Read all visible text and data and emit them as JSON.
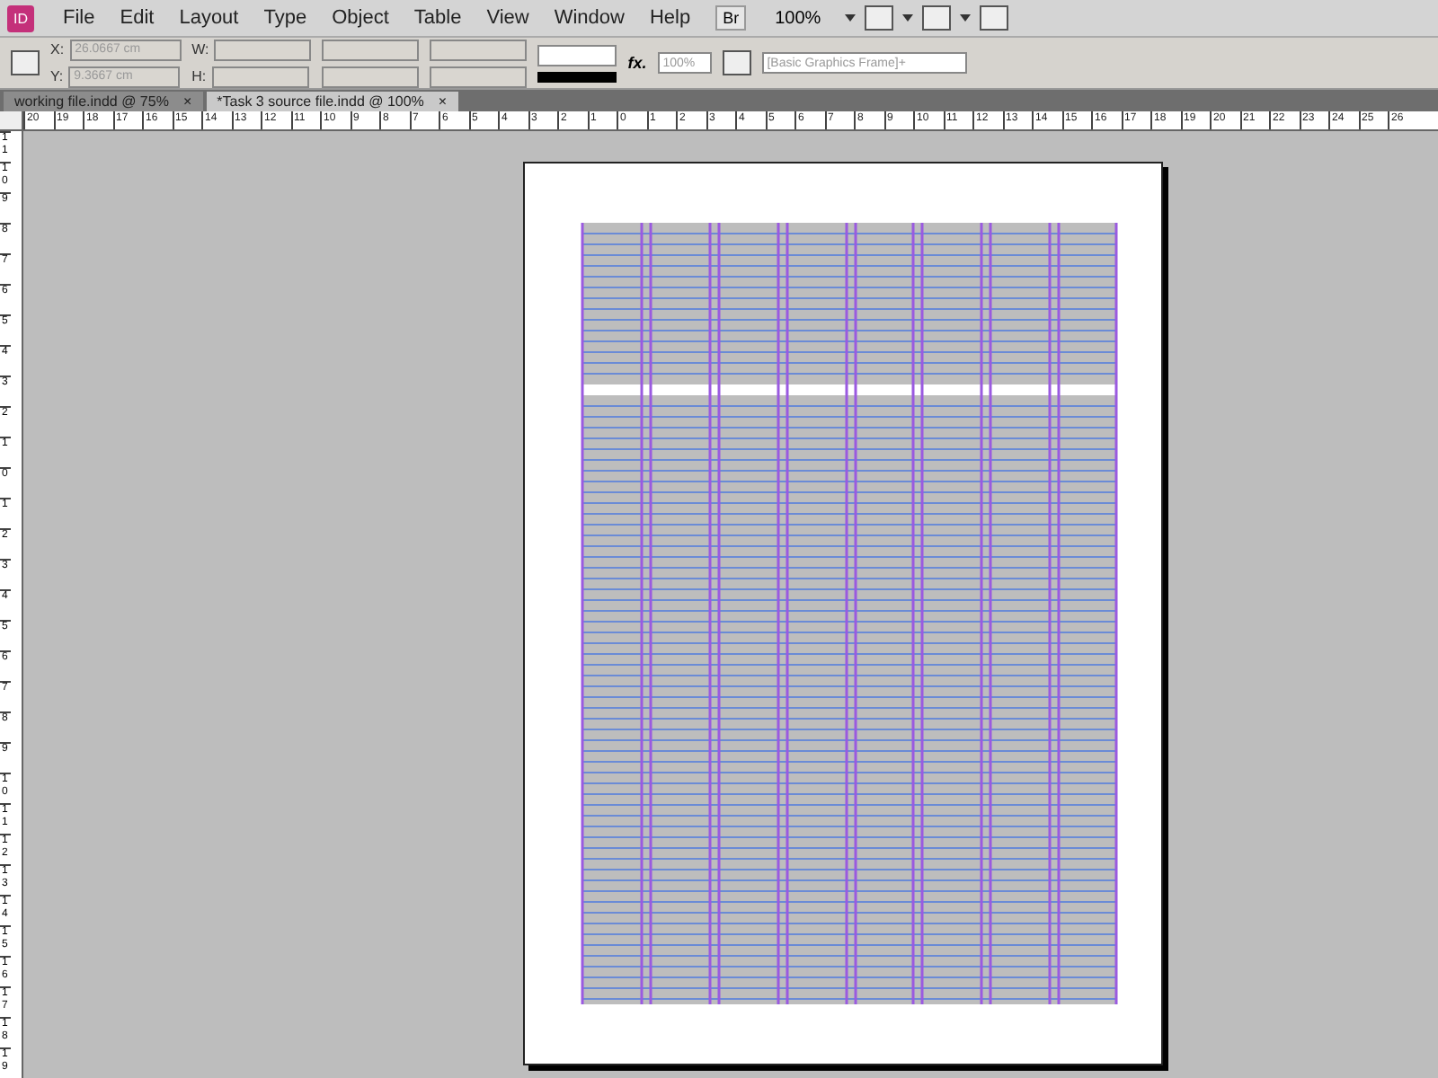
{
  "app_logo": "ID",
  "menu": [
    "File",
    "Edit",
    "Layout",
    "Type",
    "Object",
    "Table",
    "View",
    "Window",
    "Help"
  ],
  "bridge_button": "Br",
  "zoom_level": "100%",
  "control_panel": {
    "x_label": "X:",
    "x_value": "26.0667 cm",
    "y_label": "Y:",
    "y_value": "9.3667 cm",
    "w_label": "W:",
    "h_label": "H:",
    "effects": "fx.",
    "opacity": "100%",
    "object_style": "[Basic Graphics Frame]+"
  },
  "tabs": [
    {
      "label": "working file.indd @ 75%",
      "close": "×",
      "selected": false
    },
    {
      "label": "*Task 3 source file.indd @ 100%",
      "close": "×",
      "selected": true
    }
  ],
  "horizontal_ruler": [
    "20",
    "19",
    "18",
    "17",
    "16",
    "15",
    "14",
    "13",
    "12",
    "11",
    "10",
    "9",
    "8",
    "7",
    "6",
    "5",
    "4",
    "3",
    "2",
    "1",
    "0",
    "1",
    "2",
    "3",
    "4",
    "5",
    "6",
    "7",
    "8",
    "9",
    "10",
    "11",
    "12",
    "13",
    "14",
    "15",
    "16",
    "17",
    "18",
    "19",
    "20",
    "21",
    "22",
    "23",
    "24",
    "25",
    "26"
  ],
  "vertical_ruler": [
    "11",
    "10",
    "9",
    "8",
    "7",
    "6",
    "5",
    "4",
    "3",
    "2",
    "1",
    "0",
    "1",
    "2",
    "3",
    "4",
    "5",
    "6",
    "7",
    "8",
    "9",
    "10",
    "11",
    "12",
    "13",
    "14",
    "15",
    "16",
    "17",
    "18",
    "19"
  ]
}
